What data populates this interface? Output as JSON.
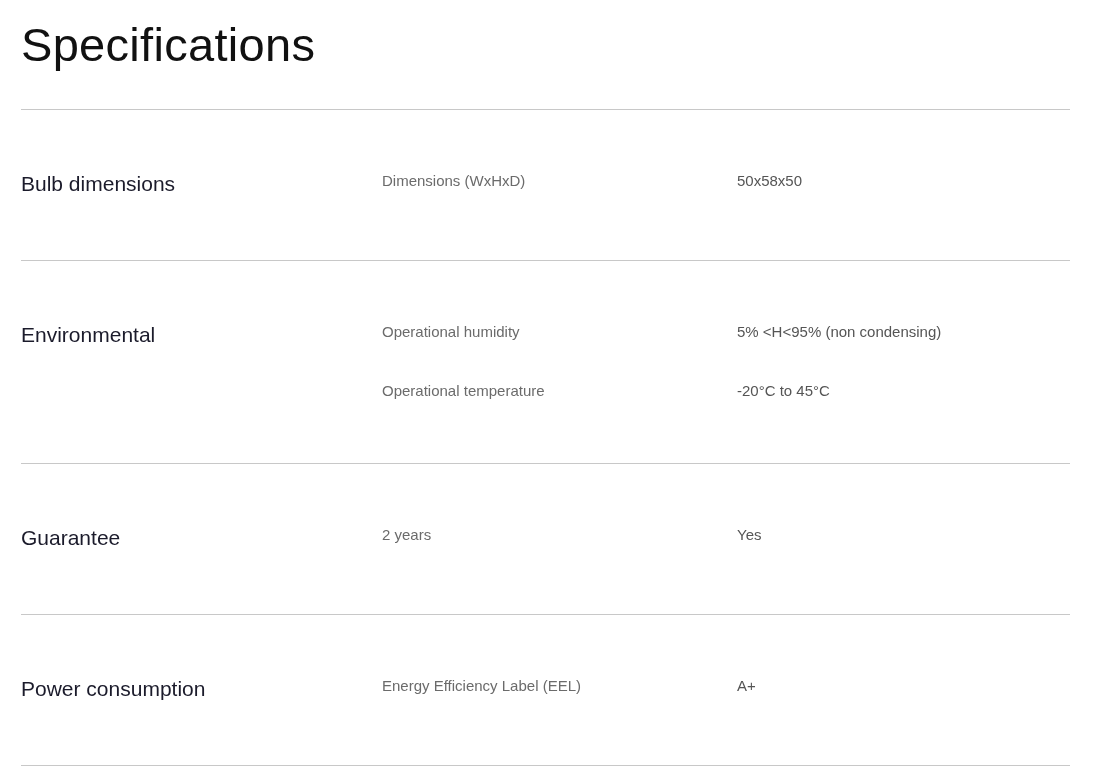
{
  "title": "Specifications",
  "sections": [
    {
      "label": "Bulb dimensions",
      "rows": [
        {
          "property": "Dimensions (WxHxD)",
          "value": "50x58x50"
        }
      ]
    },
    {
      "label": "Environmental",
      "rows": [
        {
          "property": "Operational humidity",
          "value": "5% <H<95% (non condensing)"
        },
        {
          "property": "Operational temperature",
          "value": "-20°C to 45°C"
        }
      ]
    },
    {
      "label": "Guarantee",
      "rows": [
        {
          "property": "2 years",
          "value": "Yes"
        }
      ]
    },
    {
      "label": "Power consumption",
      "rows": [
        {
          "property": "Energy Efficiency Label (EEL)",
          "value": "A+"
        }
      ]
    }
  ]
}
